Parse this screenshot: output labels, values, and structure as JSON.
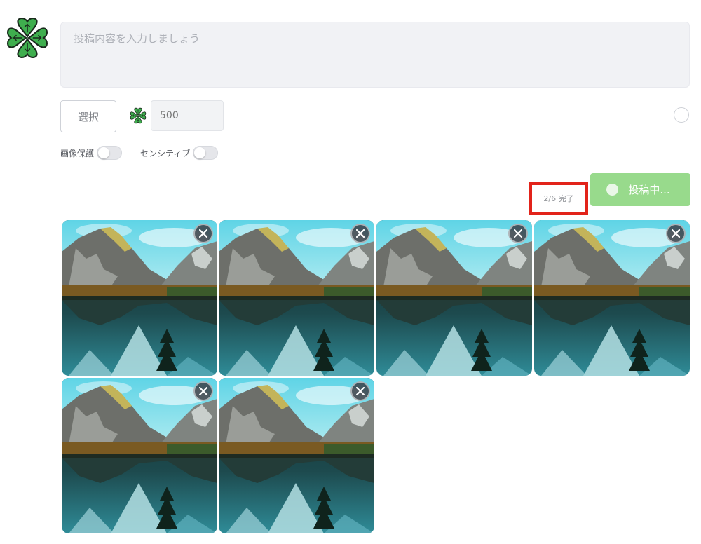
{
  "composer": {
    "placeholder": "投稿内容を入力しましょう",
    "select_label": "選択",
    "amount_placeholder": "500"
  },
  "toggles": [
    {
      "label": "画像保護",
      "on": false
    },
    {
      "label": "センシティブ",
      "on": false
    }
  ],
  "upload": {
    "progress_text": "2/6 完了",
    "completed": 2,
    "total": 6
  },
  "post_button": {
    "label": "投稿中..."
  },
  "images": [
    {
      "name": "mountain-lake"
    },
    {
      "name": "mountain-lake"
    },
    {
      "name": "mountain-lake"
    },
    {
      "name": "mountain-lake"
    },
    {
      "name": "mountain-lake"
    },
    {
      "name": "mountain-lake"
    }
  ],
  "colors": {
    "accent": "#98da8c",
    "logo": "#2e9a3e",
    "highlight": "#e2231a"
  },
  "icons": {
    "logo": "clover-logo-icon",
    "coin": "clover-coin-icon",
    "remove": "close-icon"
  }
}
